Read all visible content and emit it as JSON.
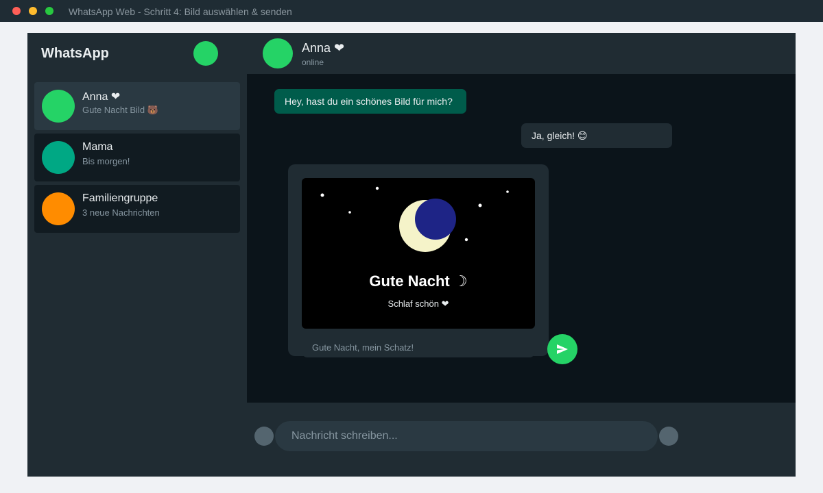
{
  "window": {
    "title": "WhatsApp Web - Schritt 4: Bild auswählen & senden"
  },
  "sidebar": {
    "brand": "WhatsApp",
    "chats": [
      {
        "name": "Anna ❤",
        "preview": "Gute Nacht Bild 🐻",
        "avatar_color": "#25d366",
        "active": true
      },
      {
        "name": "Mama",
        "preview": "Bis morgen!",
        "avatar_color": "#00a884",
        "active": false
      },
      {
        "name": "Familiengruppe",
        "preview": "3 neue Nachrichten",
        "avatar_color": "#ff8c00",
        "active": false
      }
    ]
  },
  "chat": {
    "contact_name": "Anna ❤",
    "contact_status": "online",
    "messages": [
      {
        "direction": "outgoing",
        "text": "Hey, hast du ein schönes Bild für mich?"
      },
      {
        "direction": "incoming",
        "text": "Ja, gleich! 😊"
      }
    ],
    "image_preview": {
      "title": "Gute Nacht ☽",
      "subtitle": "Schlaf schön ❤",
      "caption_placeholder": "Gute Nacht, mein Schatz!",
      "icons": [
        "moon-icon",
        "star-icon"
      ]
    },
    "send_icon": "send-icon"
  },
  "composer": {
    "placeholder": "Nachricht schreiben..."
  },
  "colors": {
    "accent": "#25d366",
    "outgoing_bubble": "#005c4b",
    "incoming_bubble": "#202c33",
    "panel": "#202c33",
    "chat_background": "#0b141a",
    "moon": "#f5f3c9",
    "moon_shadow": "#1e2486"
  }
}
